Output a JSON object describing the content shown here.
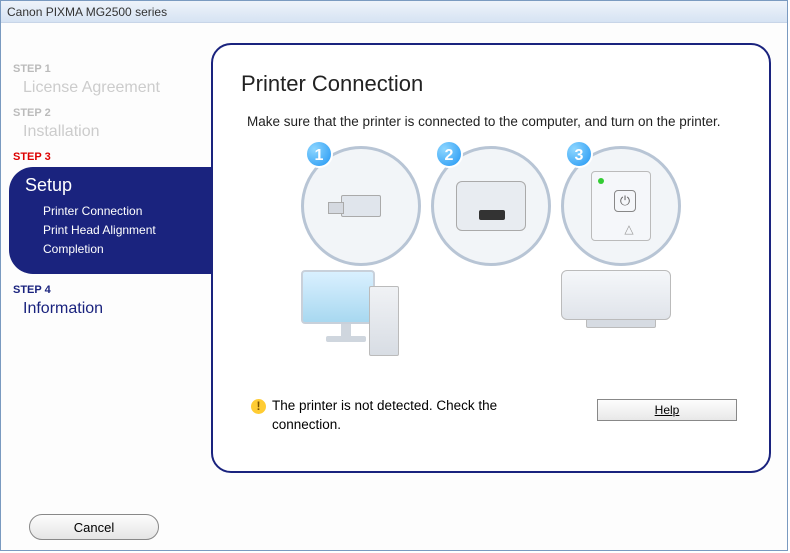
{
  "window": {
    "title": "Canon PIXMA MG2500 series"
  },
  "steps": {
    "s1": {
      "label": "STEP 1",
      "title": "License Agreement"
    },
    "s2": {
      "label": "STEP 2",
      "title": "Installation"
    },
    "s3": {
      "label": "STEP 3",
      "title": "Setup",
      "subs": [
        "Printer Connection",
        "Print Head Alignment",
        "Completion"
      ]
    },
    "s4": {
      "label": "STEP 4",
      "title": "Information"
    }
  },
  "panel": {
    "heading": "Printer Connection",
    "lead": "Make sure that the printer is connected to the computer, and turn on the printer.",
    "badges": [
      "1",
      "2",
      "3"
    ],
    "status": "The printer is not detected. Check the connection.",
    "help_label": "Help"
  },
  "footer": {
    "cancel_label": "Cancel"
  }
}
